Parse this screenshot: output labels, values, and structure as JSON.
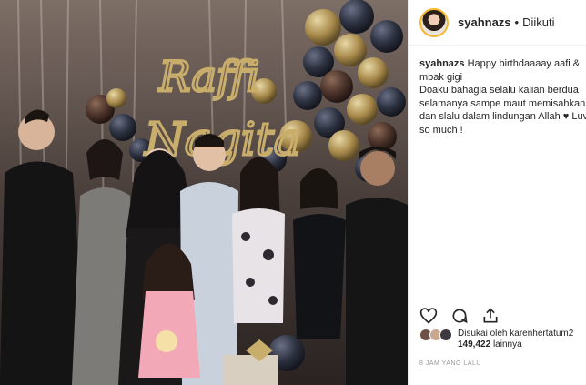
{
  "post": {
    "username": "syahnazs",
    "separator": "•",
    "follow_status": "Diikuti",
    "caption": {
      "username": "syahnazs",
      "text": "Happy birthdaaaay aafi & mbak gigi\nDoaku bahagia selalu kalian berdua selamanya sampe maut memisahkan dan slalu dalam lindungan Allah ♥ Luvvv so much !"
    },
    "likes": {
      "prefix": "Disukai oleh",
      "user": "karenhertatum2",
      "count": "149,422",
      "suffix": "lainnya"
    },
    "timestamp": "8 JAM YANG LALU"
  },
  "photo": {
    "balloon_letters_top": "Raffi",
    "balloon_letters_bottom": "Nagita"
  },
  "icons": {
    "like": "heart-icon",
    "comment": "comment-icon",
    "share": "share-icon"
  },
  "colors": {
    "story_ring": "#f5b82e",
    "text": "#262626",
    "muted": "#999999",
    "balloon_gold": "#b89a57",
    "balloon_dark": "#2a2f3d"
  }
}
